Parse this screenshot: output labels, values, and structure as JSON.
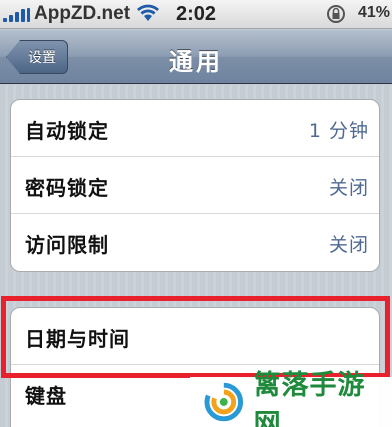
{
  "status_bar": {
    "carrier": "AppZD.net",
    "time": "2:02",
    "battery": "41%"
  },
  "nav": {
    "back_label": "设置",
    "title": "通用"
  },
  "groups": [
    {
      "rows": [
        {
          "label": "自动锁定",
          "value": "1 分钟"
        },
        {
          "label": "密码锁定",
          "value": "关闭"
        },
        {
          "label": "访问限制",
          "value": "关闭"
        }
      ]
    },
    {
      "rows": [
        {
          "label": "日期与时间",
          "value": ""
        },
        {
          "label": "键盘",
          "value": ""
        }
      ]
    }
  ],
  "watermark": {
    "text": "篱落手游网"
  },
  "colors": {
    "highlight": "#e8212c",
    "value_text": "#4f6a92",
    "watermark_green": "#1f8a3c"
  }
}
